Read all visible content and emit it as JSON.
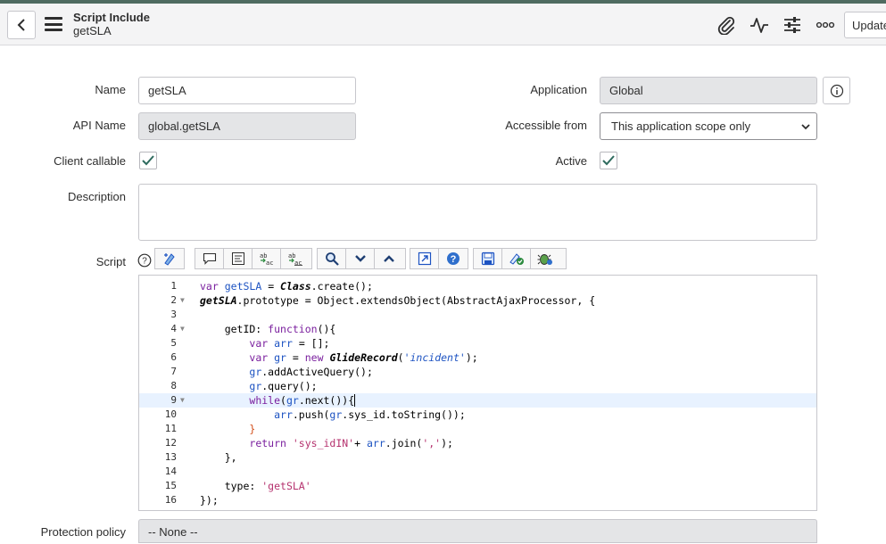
{
  "header": {
    "record_type": "Script Include",
    "record_name": "getSLA",
    "update_label": "Update"
  },
  "form": {
    "name_label": "Name",
    "name_value": "getSLA",
    "api_name_label": "API Name",
    "api_name_value": "global.getSLA",
    "client_callable_label": "Client callable",
    "client_callable_checked": true,
    "description_label": "Description",
    "description_value": "",
    "application_label": "Application",
    "application_value": "Global",
    "accessible_from_label": "Accessible from",
    "accessible_from_value": "This application scope only",
    "active_label": "Active",
    "active_checked": true,
    "script_label": "Script",
    "protection_label": "Protection policy",
    "protection_value": "-- None --"
  },
  "script": {
    "line_numbers": [
      "1",
      "2",
      "3",
      "4",
      "5",
      "6",
      "7",
      "8",
      "9",
      "10",
      "11",
      "12",
      "13",
      "14",
      "15",
      "16"
    ],
    "active_line": 9,
    "fold_lines": [
      2,
      4,
      9
    ]
  },
  "colors": {
    "top_bar": "#4f6b61",
    "check": "#2e6b5e",
    "keyword": "#7a1f9e",
    "variable": "#1d53c2",
    "string": "#b5326e"
  }
}
